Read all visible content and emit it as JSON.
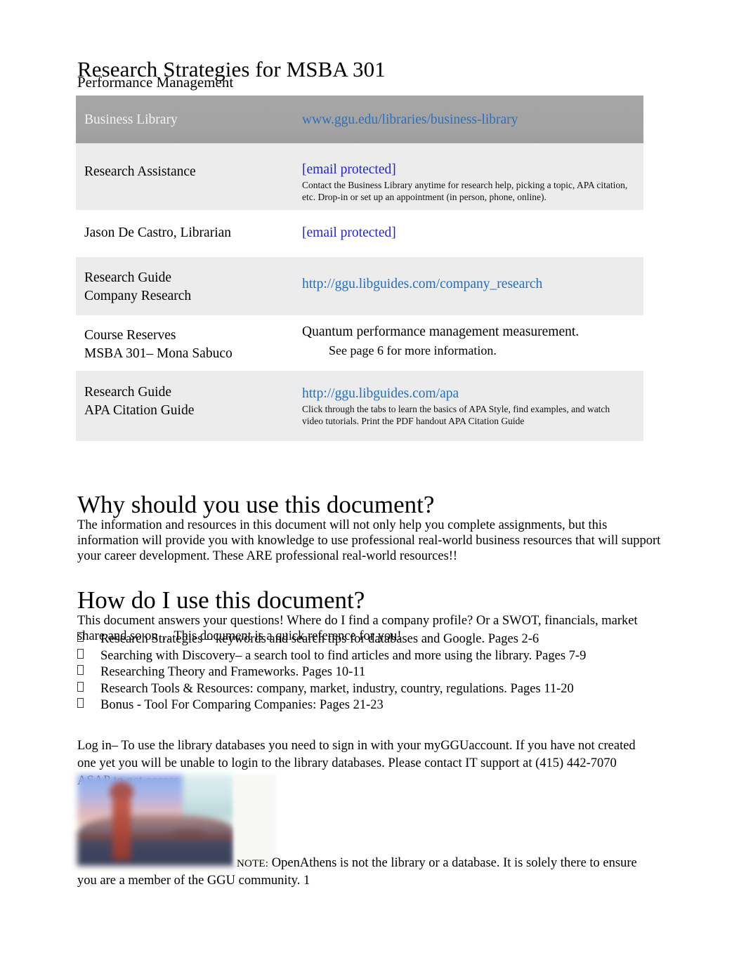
{
  "document": {
    "title": "Research Strategies for MSBA 301",
    "subtitle": "Performance Management"
  },
  "resource_table": {
    "header": {
      "label": "Business Library",
      "link_text": "www.ggu.edu/libraries/business-library"
    },
    "rows": [
      {
        "label": "Research Assistance",
        "link_text": "[email protected]",
        "note": "Contact the Business Library anytime for research help, picking a topic, APA citation, etc. Drop-in or set up an appointment (in person, phone, online)."
      },
      {
        "label": "Jason De Castro, Librarian",
        "link_text": "[email protected]",
        "note": ""
      },
      {
        "label_line1": "Research Guide",
        "label_line2": "Company Research",
        "link_text": "http://ggu.libguides.com/company_research",
        "note": ""
      },
      {
        "label_line1": "Course Reserves",
        "label_line2": "MSBA 301– Mona Sabuco",
        "value_main": "Quantum performance management measurement.",
        "value_indent": "See page 6 for more information."
      },
      {
        "label_line1": "Research Guide",
        "label_line2": "APA Citation Guide",
        "link_text": "http://ggu.libguides.com/apa",
        "note": "Click through the tabs to learn the basics of APA Style, find examples, and watch video tutorials. Print the PDF handout  APA Citation Guide"
      }
    ]
  },
  "sections": {
    "why": {
      "heading": "Why should you use this document?",
      "paragraph": "The information and resources in this document will not only help you complete assignments, but this information will provide you with knowledge to use professional real-world business resources that will support your career development. These ARE professional real-world resources!!"
    },
    "how": {
      "heading": "How do I use this document?",
      "paragraph": "This document answers your questions! Where do I find a company profile? Or a SWOT, financials, market share and so on… This document is a quick reference for you!",
      "bullets": [
        "Research Strategies  – keywords and search tips for databases and Google. Pages 2-6",
        "Searching with Discovery– a search tool to find articles and more using the library. Pages 7-9",
        "Researching Theory and Frameworks. Pages 10-11",
        "Research Tools & Resources: company, market, industry, country, regulations. Pages 11-20",
        "Bonus - Tool For Comparing Companies: Pages 21-23"
      ]
    }
  },
  "login_paragraph": "Log in– To use the library databases you need to sign in with your  myGGUaccount. If you have not created one yet you will be unable to login to the library databases.    Please contact IT support at (415) 442-7070 ASAP to get access.",
  "footer": {
    "note_label": "NOTE:",
    "note_text": "OpenAthens is not the library or a database.    It is solely there to ensure",
    "note_text_line2": "you are a member of the GGU community. 1"
  },
  "colors": {
    "link_blue": "#1f6fc4",
    "link_email": "#2424cc",
    "header_gray": "#a3a3a3",
    "row_shaded": "#ececec"
  }
}
